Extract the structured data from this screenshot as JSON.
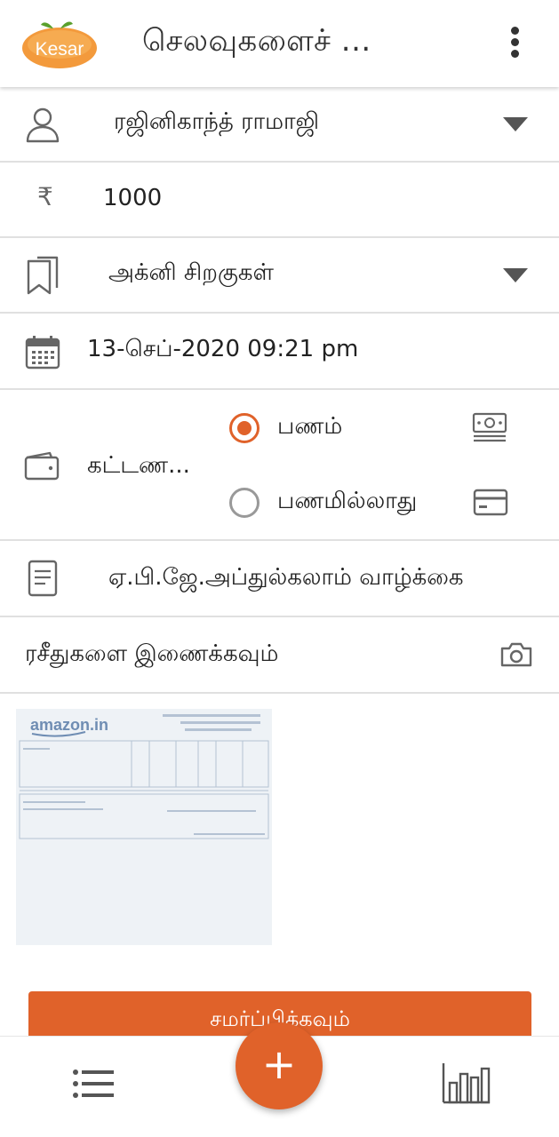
{
  "app": {
    "logo_text": "Kesar",
    "title": "செலவுகளைச் ...",
    "brand_color": "#e0622a"
  },
  "form": {
    "person": {
      "value": "ரஜினிகாந்த் ராமாஜி",
      "icon": "person-icon"
    },
    "amount": {
      "currency_symbol": "₹",
      "value": "1000"
    },
    "category": {
      "value": "அக்னி சிறகுகள்",
      "icon": "bookmark-icon"
    },
    "datetime": {
      "value": "13-செப்-2020 09:21 pm",
      "icon": "calendar-icon"
    },
    "payment": {
      "label": "கட்டண...",
      "options": [
        {
          "label": "பணம்",
          "selected": true,
          "icon": "cash-icon"
        },
        {
          "label": "பணமில்லாது",
          "selected": false,
          "icon": "card-icon"
        }
      ]
    },
    "note": {
      "value": "ஏ.பி.ஜே.அப்துல்கலாம் வாழ்க்கை",
      "icon": "document-icon"
    },
    "receipts": {
      "label": "ரசீதுகளை இணைக்கவும்",
      "icon": "camera-icon",
      "thumbnail_brand": "amazon.in"
    }
  },
  "submit_label": "சமர்ப்பிக்கவும்",
  "bottom_nav": {
    "fab_label": "+",
    "left_icon": "list-icon",
    "right_icon": "bar-chart-icon"
  }
}
